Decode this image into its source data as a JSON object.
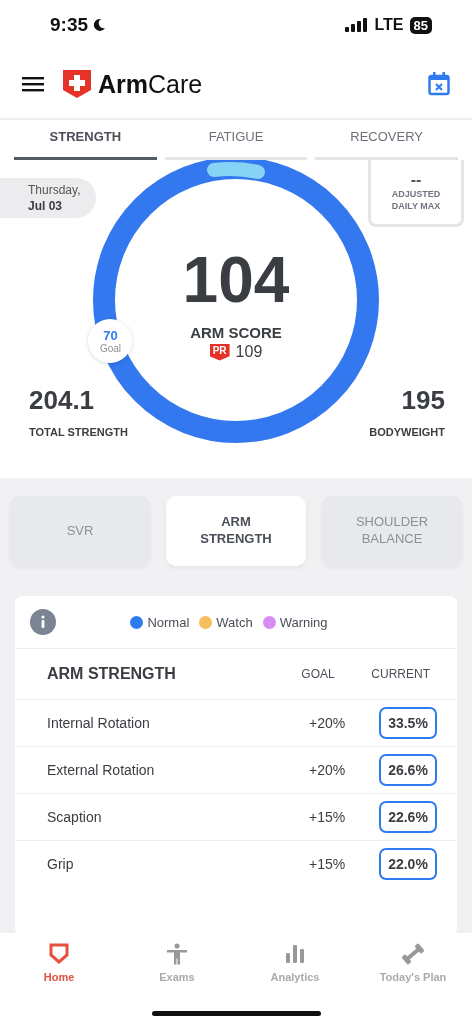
{
  "status_bar": {
    "time": "9:35",
    "network": "LTE",
    "battery": "85"
  },
  "header": {
    "brand_bold": "Arm",
    "brand_light": "Care"
  },
  "tabs": [
    {
      "label": "STRENGTH",
      "selected": true
    },
    {
      "label": "FATIGUE",
      "selected": false
    },
    {
      "label": "RECOVERY",
      "selected": false
    }
  ],
  "score": {
    "date_day": "Thursday,",
    "date": "Jul 03",
    "value": "104",
    "label": "ARM SCORE",
    "pr_badge": "PR",
    "pr_value": "109",
    "goal": "70",
    "goal_label": "Goal",
    "adjusted_value": "--",
    "adjusted_label": "ADJUSTED DAILY MAX",
    "total_strength": "204.1",
    "total_strength_label": "TOTAL STRENGTH",
    "bodyweight": "195",
    "bodyweight_label": "BODYWEIGHT"
  },
  "segments": [
    {
      "label": "SVR",
      "selected": false
    },
    {
      "label": "ARM STRENGTH",
      "selected": true
    },
    {
      "label": "SHOULDER BALANCE",
      "selected": false
    }
  ],
  "legend": [
    {
      "label": "Normal",
      "color": "#2f7bf0"
    },
    {
      "label": "Watch",
      "color": "#f5bd5c"
    },
    {
      "label": "Warning",
      "color": "#d88cf2"
    }
  ],
  "table": {
    "title": "ARM STRENGTH",
    "columns": [
      "GOAL",
      "CURRENT"
    ],
    "rows": [
      {
        "name": "Internal Rotation",
        "goal": "+20%",
        "current": "33.5%"
      },
      {
        "name": "External Rotation",
        "goal": "+20%",
        "current": "26.6%"
      },
      {
        "name": "Scaption",
        "goal": "+15%",
        "current": "22.6%"
      },
      {
        "name": "Grip",
        "goal": "+15%",
        "current": "22.0%"
      }
    ]
  },
  "bottom_nav": [
    {
      "label": "Home",
      "selected": true,
      "kind": "home"
    },
    {
      "label": "Exams",
      "selected": false,
      "kind": "person"
    },
    {
      "label": "Analytics",
      "selected": false,
      "kind": "bars"
    },
    {
      "label": "Today's Plan",
      "selected": false,
      "kind": "dumbbell"
    }
  ]
}
